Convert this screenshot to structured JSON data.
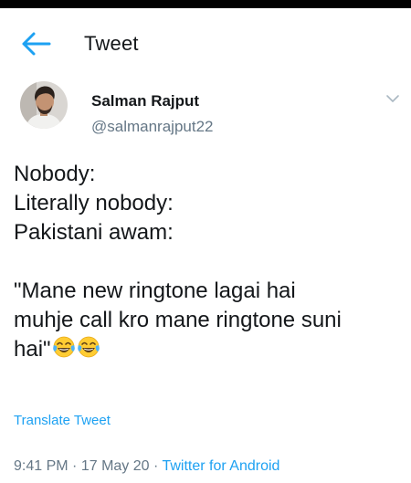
{
  "header": {
    "title": "Tweet",
    "back_icon": "arrow-left-icon"
  },
  "tweet": {
    "author": {
      "name": "Salman Rajput",
      "handle": "@salmanrajput22"
    },
    "text_lines": [
      "Nobody:",
      "Literally nobody:",
      "Pakistani awam:",
      "",
      "\"Mane new ringtone lagai hai",
      "muhje call kro mane ringtone suni",
      "hai\""
    ],
    "emojis": [
      "face-with-tears-of-joy-icon",
      "face-with-tears-of-joy-icon"
    ],
    "translate_label": "Translate Tweet",
    "time": "9:41 PM",
    "separator": "·",
    "date": "17 May 20",
    "source": "Twitter for Android"
  },
  "colors": {
    "accent": "#1da1f2",
    "text": "#14171a",
    "secondary": "#657786"
  }
}
